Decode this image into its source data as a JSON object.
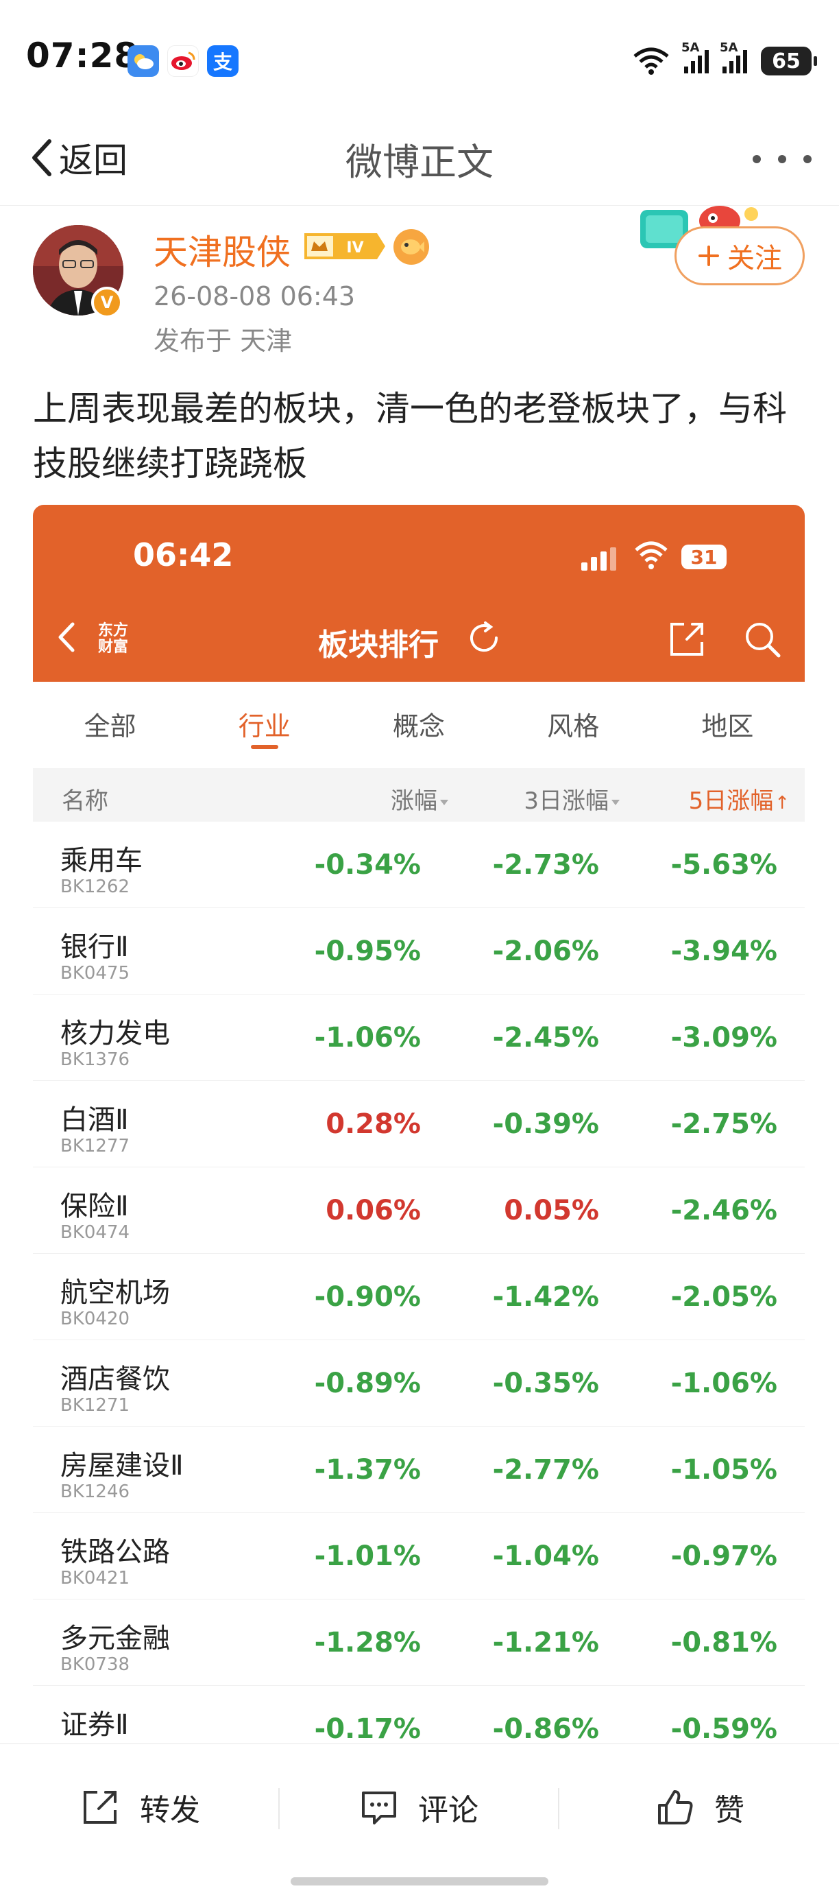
{
  "status_bar": {
    "time": "07:28",
    "signal1": "6",
    "signal2": "5A",
    "signal3": "5A",
    "battery": "65"
  },
  "nav": {
    "back_label": "返回",
    "title": "微博正文"
  },
  "post": {
    "author": "天津股侠",
    "vip_level": "IV",
    "time": "26-08-08 06:43",
    "location": "发布于 天津",
    "follow_label": "关注",
    "text": "上周表现最差的板块，清一色的老登板块了，与科技股继续打跷跷板"
  },
  "screenshot": {
    "time": "06:42",
    "battery": "31",
    "app_logo": "东方财富",
    "title": "板块排行",
    "tabs": [
      "全部",
      "行业",
      "概念",
      "风格",
      "地区"
    ],
    "active_tab": 1,
    "columns": [
      "名称",
      "涨幅",
      "3日涨幅",
      "5日涨幅"
    ],
    "rows": [
      {
        "name": "乘用车",
        "code": "BK1262",
        "chg": "-0.34%",
        "chg3": "-2.73%",
        "chg5": "-5.63%"
      },
      {
        "name": "银行Ⅱ",
        "code": "BK0475",
        "chg": "-0.95%",
        "chg3": "-2.06%",
        "chg5": "-3.94%"
      },
      {
        "name": "核力发电",
        "code": "BK1376",
        "chg": "-1.06%",
        "chg3": "-2.45%",
        "chg5": "-3.09%"
      },
      {
        "name": "白酒Ⅱ",
        "code": "BK1277",
        "chg": "0.28%",
        "chg3": "-0.39%",
        "chg5": "-2.75%"
      },
      {
        "name": "保险Ⅱ",
        "code": "BK0474",
        "chg": "0.06%",
        "chg3": "0.05%",
        "chg5": "-2.46%"
      },
      {
        "name": "航空机场",
        "code": "BK0420",
        "chg": "-0.90%",
        "chg3": "-1.42%",
        "chg5": "-2.05%"
      },
      {
        "name": "酒店餐饮",
        "code": "BK1271",
        "chg": "-0.89%",
        "chg3": "-0.35%",
        "chg5": "-1.06%"
      },
      {
        "name": "房屋建设Ⅱ",
        "code": "BK1246",
        "chg": "-1.37%",
        "chg3": "-2.77%",
        "chg5": "-1.05%"
      },
      {
        "name": "铁路公路",
        "code": "BK0421",
        "chg": "-1.01%",
        "chg3": "-1.04%",
        "chg5": "-0.97%"
      },
      {
        "name": "多元金融",
        "code": "BK0738",
        "chg": "-1.28%",
        "chg3": "-1.21%",
        "chg5": "-0.81%"
      },
      {
        "name": "证券Ⅱ",
        "code": "",
        "chg": "-0.17%",
        "chg3": "-0.86%",
        "chg5": "-0.59%"
      }
    ]
  },
  "actions": {
    "repost": "转发",
    "comment": "评论",
    "like": "赞"
  },
  "colors": {
    "accent": "#f07020",
    "screenshot_header": "#e2622a",
    "negative": "#3aa245",
    "positive": "#d2382f"
  }
}
